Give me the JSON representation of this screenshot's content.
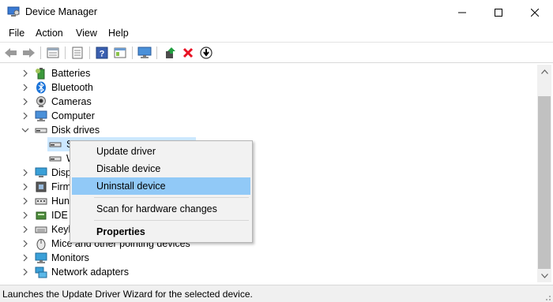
{
  "window": {
    "title": "Device Manager"
  },
  "menu": [
    "File",
    "Action",
    "View",
    "Help"
  ],
  "toolbar_icons": [
    "back-icon",
    "forward-icon",
    "properties-icon",
    "scan-icon",
    "help-icon",
    "details-icon",
    "monitor-icon",
    "update-driver-icon",
    "uninstall-icon",
    "download-icon"
  ],
  "tree": {
    "items": [
      {
        "label": "Batteries",
        "icon": "battery-icon",
        "expanded": false
      },
      {
        "label": "Bluetooth",
        "icon": "bluetooth-icon",
        "expanded": false
      },
      {
        "label": "Cameras",
        "icon": "camera-icon",
        "expanded": false
      },
      {
        "label": "Computer",
        "icon": "computer-icon",
        "expanded": false
      },
      {
        "label": "Disk drives",
        "icon": "disk-drive-icon",
        "expanded": true
      },
      {
        "label": "S",
        "icon": "disk-drive-icon",
        "child": true,
        "selected": true
      },
      {
        "label": "W",
        "icon": "disk-drive-icon",
        "child": true
      },
      {
        "label": "Disp",
        "icon": "display-icon",
        "expanded": false
      },
      {
        "label": "Firm",
        "icon": "firmware-icon",
        "expanded": false
      },
      {
        "label": "Hun",
        "icon": "hid-icon",
        "expanded": false
      },
      {
        "label": "IDE A",
        "icon": "ide-icon",
        "expanded": false
      },
      {
        "label": "Keyb",
        "icon": "keyboard-icon",
        "expanded": false
      },
      {
        "label": "Mice and other pointing devices",
        "icon": "mouse-icon",
        "expanded": false
      },
      {
        "label": "Monitors",
        "icon": "monitor-icon",
        "expanded": false
      },
      {
        "label": "Network adapters",
        "icon": "network-icon",
        "expanded": false
      }
    ]
  },
  "context_menu": {
    "items": [
      {
        "label": "Update driver"
      },
      {
        "label": "Disable device"
      },
      {
        "label": "Uninstall device",
        "highlighted": true
      },
      {
        "label": "Scan for hardware changes"
      },
      {
        "label": "Properties",
        "bold": true
      }
    ]
  },
  "status": {
    "text": "Launches the Update Driver Wizard for the selected device."
  },
  "colors": {
    "selection": "#cce8ff",
    "menu_highlight": "#91c9f7",
    "uninstall_red": "#e81123"
  }
}
